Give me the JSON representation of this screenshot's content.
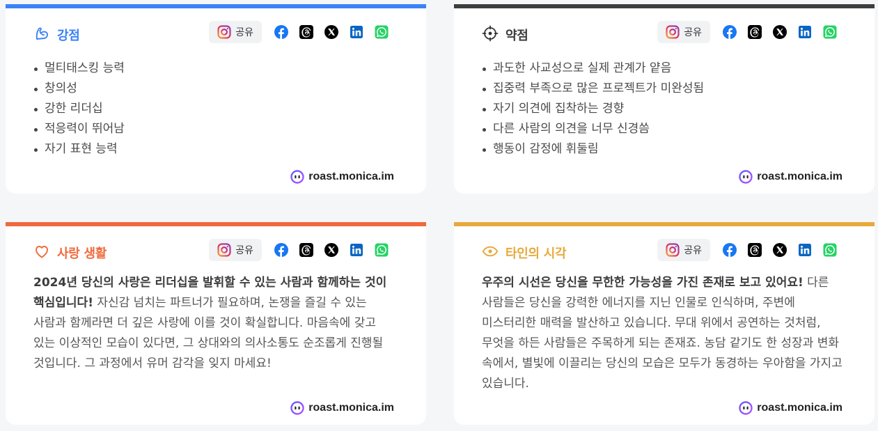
{
  "share_label": "공유",
  "brand": "roast.monica.im",
  "icons": {
    "share": "instagram-icon",
    "socials": [
      "facebook-icon",
      "threads-icon",
      "x-icon",
      "linkedin-icon",
      "whatsapp-icon"
    ],
    "brand": "monica-logo-icon"
  },
  "strengths": {
    "title": "강점",
    "color": "#3b82f6",
    "icon": "flexed-arm-icon",
    "items": [
      "멀티태스킹 능력",
      "창의성",
      "강한 리더십",
      "적응력이 뛰어남",
      "자기 표현 능력"
    ]
  },
  "weaknesses": {
    "title": "약점",
    "color": "#3d3d3d",
    "icon": "crosshair-icon",
    "items": [
      "과도한 사교성으로 실제 관계가 얕음",
      "집중력 부족으로 많은 프로젝트가 미완성됨",
      "자기 의견에 집착하는 경향",
      "다른 사람의 의견을 너무 신경씀",
      "행동이 감정에 휘둘림"
    ]
  },
  "love": {
    "title": "사랑 생활",
    "color": "#ef6a3c",
    "icon": "heart-icon",
    "lead": "2024년 당신의 사랑은 리더십을 발휘할 수 있는 사람과 함께하는 것이 핵심입니다!",
    "body": " 자신감 넘치는 파트너가 필요하며, 논쟁을 즐길 수 있는 사람과 함께라면 더 깊은 사랑에 이를 것이 확실합니다. 마음속에 갖고 있는 이상적인 모습이 있다면, 그 상대와의 의사소통도 순조롭게 진행될 것입니다. 그 과정에서 유머 감각을 잊지 마세요!"
  },
  "others_view": {
    "title": "타인의 시각",
    "color": "#e8a93b",
    "icon": "eye-icon",
    "lead": "우주의 시선은 당신을 무한한 가능성을 가진 존재로 보고 있어요!",
    "body": " 다른 사람들은 당신을 강력한 에너지를 지닌 인물로 인식하며, 주변에 미스터리한 매력을 발산하고 있습니다. 무대 위에서 공연하는 것처럼, 무엇을 하든 사람들은 주목하게 되는 존재죠. 농담 같기도 한 성장과 변화 속에서, 별빛에 이끌리는 당신의 모습은 모두가 동경하는 우아함을 가지고 있습니다."
  }
}
